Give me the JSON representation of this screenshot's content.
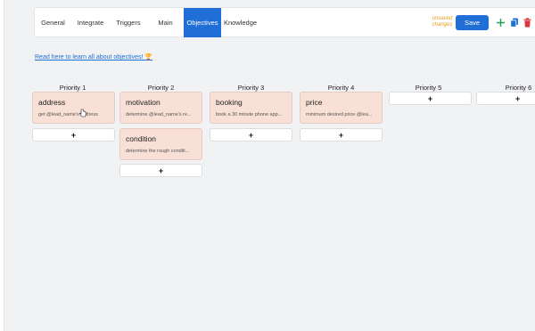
{
  "tabs": [
    {
      "label": "General"
    },
    {
      "label": "Integrate"
    },
    {
      "label": "Triggers"
    },
    {
      "label": "Main"
    },
    {
      "label": "Objectives"
    },
    {
      "label": "Knowledge"
    }
  ],
  "active_tab": "Objectives",
  "header": {
    "unsaved_label": "unsaved changes",
    "save_label": "Save"
  },
  "icons": {
    "add": "plus-icon",
    "copy": "copy-icon",
    "delete": "trash-icon"
  },
  "colors": {
    "accent": "#1f6fd6",
    "unsaved": "#e3a11f",
    "add_icon": "#1aa05a",
    "delete_icon": "#d9363e",
    "card_bg": "#f9e0d6"
  },
  "learn_link": "Read here to learn all about objectives! 🏆",
  "columns": [
    {
      "header": "Priority 1",
      "cards": [
        {
          "title": "address",
          "desc": "get @lead_name's address"
        }
      ],
      "add_label": "+"
    },
    {
      "header": "Priority 2",
      "cards": [
        {
          "title": "motivation",
          "desc": "determine @lead_name's re..."
        },
        {
          "title": "condition",
          "desc": "determine the rough conditi..."
        }
      ],
      "add_label": "+"
    },
    {
      "header": "Priority 3",
      "cards": [
        {
          "title": "booking",
          "desc": "book a 30 minute phone app..."
        }
      ],
      "add_label": "+"
    },
    {
      "header": "Priority 4",
      "cards": [
        {
          "title": "price",
          "desc": "minimum desired price @lea..."
        }
      ],
      "add_label": "+"
    },
    {
      "header": "Priority 5",
      "cards": [],
      "add_label": "+"
    },
    {
      "header": "Priority 6",
      "cards": [],
      "add_label": "+"
    }
  ]
}
